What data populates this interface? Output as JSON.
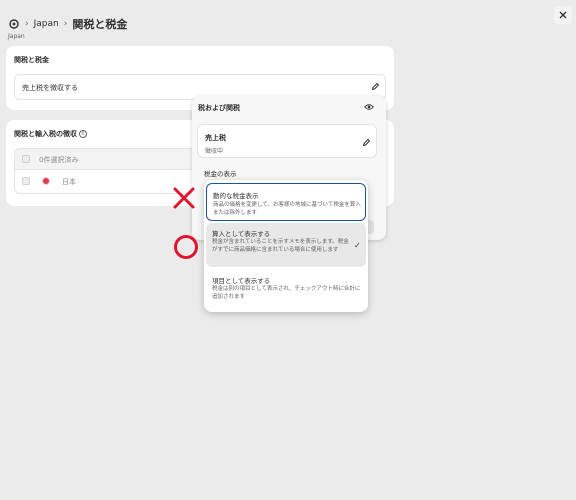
{
  "header": {
    "breadcrumb_parent": "Japan",
    "separator": "›",
    "title": "関税と税金",
    "subtitle": "Japan"
  },
  "close_label": "×",
  "duties_card": {
    "title": "関税と税金",
    "row_text": "売上税を徴収する"
  },
  "import_card": {
    "title": "関税と輸入税の徴収",
    "info_glyph": "i",
    "header_text": "0件選択済み",
    "row_country": "日本"
  },
  "tax_panel": {
    "title": "税および関税",
    "sales_tax_label": "売上税",
    "sales_tax_status": "徴収中",
    "display_label": "税金の表示"
  },
  "dropdown": {
    "options": [
      {
        "title": "動的な税金表示",
        "desc": "商品の価格を変更して、お客様の地域に基づいて税金を算入または除外します"
      },
      {
        "title": "算入として表示する",
        "desc": "税金が含まれていることを示すメモを表示します。税金がすでに商品価格に含まれている場合に使用します",
        "check": "✓"
      },
      {
        "title": "項目として表示する",
        "desc": "税金は別の項目として表示され、チェックアウト時に合計に追加されます"
      }
    ]
  },
  "colors": {
    "annotation_red": "#e0142c",
    "focus_blue": "#1f5199",
    "flag_red": "#d9414e"
  }
}
